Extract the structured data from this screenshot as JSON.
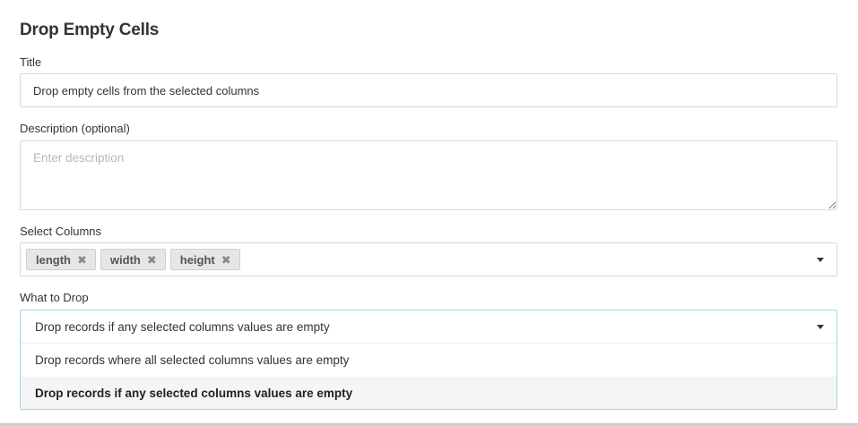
{
  "header": {
    "title": "Drop Empty Cells"
  },
  "title_field": {
    "label": "Title",
    "value": "Drop empty cells from the selected columns"
  },
  "description_field": {
    "label": "Description (optional)",
    "placeholder": "Enter description",
    "value": ""
  },
  "columns_field": {
    "label": "Select Columns",
    "selected": [
      "length",
      "width",
      "height"
    ],
    "remove_glyph": "✖",
    "icon": "chevron-down-icon"
  },
  "drop_field": {
    "label": "What to Drop",
    "selected_value": "Drop records if any selected columns values are empty",
    "options": [
      "Drop records where all selected columns values are empty",
      "Drop records if any selected columns values are empty"
    ],
    "highlighted_option_index": 1,
    "icon": "chevron-down-icon"
  },
  "colors": {
    "focus_border": "#a6d4e0",
    "chip_bg": "#e6e6e6",
    "input_border": "#d8d8d8"
  }
}
